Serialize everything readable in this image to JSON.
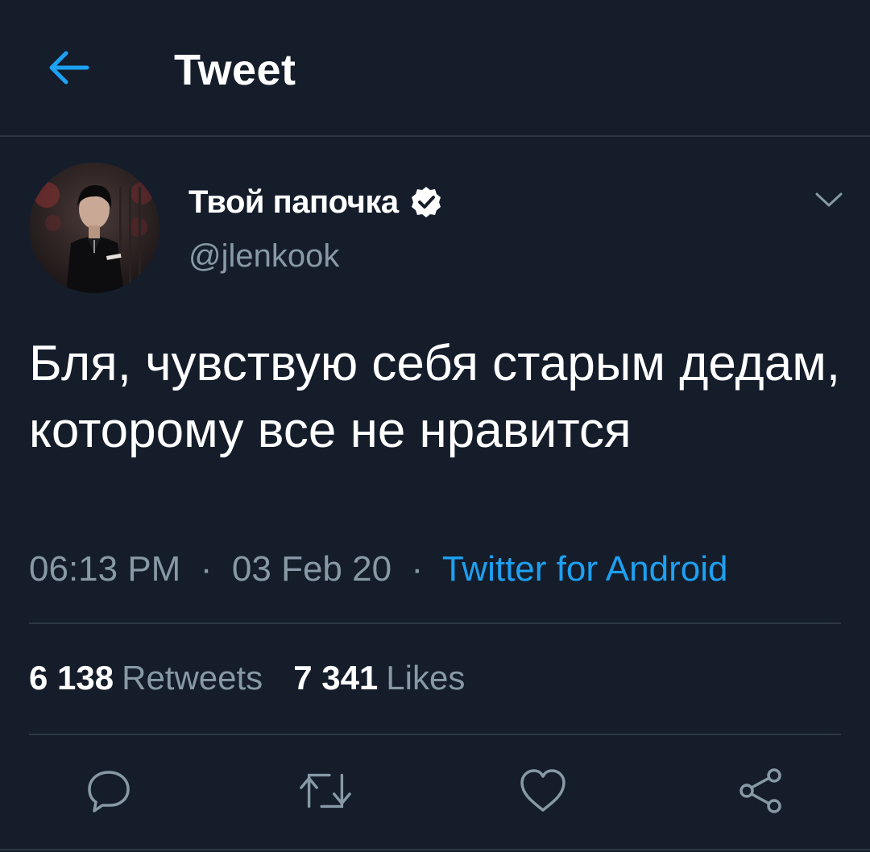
{
  "header": {
    "title": "Tweet",
    "back_icon": "arrow-left-icon"
  },
  "author": {
    "display_name": "Твой папочка",
    "handle": "@jlenkook",
    "verified_icon": "verified-badge-icon",
    "avatar_icon": "avatar"
  },
  "tweet": {
    "text": "Бля, чувствую себя старым дедам, которому все не нравится",
    "time": "06:13 PM",
    "separator": "·",
    "date": "03 Feb 20",
    "source": "Twitter for Android"
  },
  "stats": {
    "retweets_count": "6 138",
    "retweets_label": "Retweets",
    "likes_count": "7 341",
    "likes_label": "Likes"
  },
  "actions": [
    {
      "icon": "reply-icon"
    },
    {
      "icon": "retweet-icon"
    },
    {
      "icon": "like-icon"
    },
    {
      "icon": "share-icon"
    }
  ],
  "colors": {
    "background": "#151d2b",
    "accent": "#1da1f2",
    "secondary_text": "#8899a6",
    "divider": "#2c3744"
  }
}
